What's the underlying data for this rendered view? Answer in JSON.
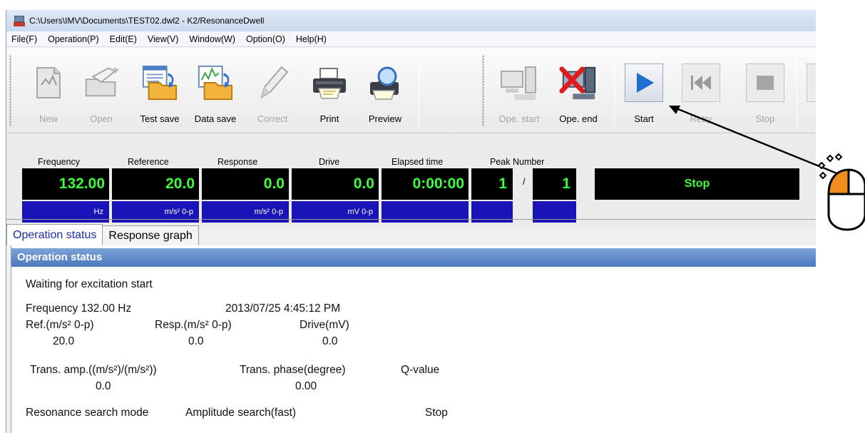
{
  "window": {
    "title": "C:\\Users\\IMV\\Documents\\TEST02.dwl2 - K2/ResonanceDwell"
  },
  "menu": [
    "File(F)",
    "Operation(P)",
    "Edit(E)",
    "View(V)",
    "Window(W)",
    "Option(O)",
    "Help(H)"
  ],
  "toolbar": {
    "new": "New",
    "open": "Open",
    "test_save": "Test save",
    "data_save": "Data save",
    "correct": "Correct",
    "print": "Print",
    "preview": "Preview",
    "ope_start": "Ope. start",
    "ope_end": "Ope. end",
    "start": "Start",
    "retry": "Retry",
    "stop": "Stop"
  },
  "readouts": {
    "frequency": {
      "label": "Frequency",
      "value": "132.00",
      "unit": "Hz"
    },
    "reference": {
      "label": "Reference",
      "value": "20.0",
      "unit": "m/s² 0-p"
    },
    "response": {
      "label": "Response",
      "value": "0.0",
      "unit": "m/s² 0-p"
    },
    "drive": {
      "label": "Drive",
      "value": "0.0",
      "unit": "mV 0-p"
    },
    "elapsed": {
      "label": "Elapsed time",
      "value": "0:00:00"
    },
    "peak": {
      "label": "Peak Number",
      "current": "1",
      "separator": "/",
      "total": "1"
    },
    "status": "Stop"
  },
  "tabs": [
    "Operation status",
    "Response graph"
  ],
  "operation_status": {
    "header": "Operation status",
    "message": "Waiting for excitation start",
    "frequency_line": "Frequency 132.00 Hz",
    "timestamp": "2013/07/25 4:45:12 PM",
    "ref_label": "Ref.(m/s² 0-p)",
    "resp_label": "Resp.(m/s² 0-p)",
    "drive_label": "Drive(mV)",
    "ref_value": "20.0",
    "resp_value": "0.0",
    "drive_value": "0.0",
    "trans_amp_label": "Trans. amp.((m/s²)/(m/s²))",
    "trans_phase_label": "Trans. phase(degree)",
    "q_label": "Q-value",
    "trans_amp_value": "0.0",
    "trans_phase_value": "0.00",
    "mode_label": "Resonance search mode",
    "mode_value": "Amplitude search(fast)",
    "mode_state": "Stop"
  },
  "colors": {
    "readout_text": "#39ff3a",
    "unit_bar": "#1a14b8",
    "section_header": "#4a78c0",
    "active_tab_text": "#1c2bb8"
  }
}
